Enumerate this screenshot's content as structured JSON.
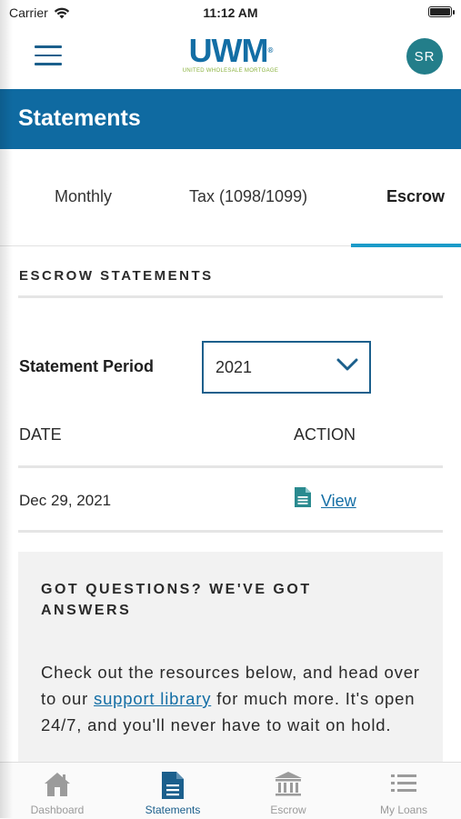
{
  "status_bar": {
    "carrier": "Carrier",
    "time": "11:12 AM"
  },
  "header": {
    "logo": "UWM",
    "logo_tagline": "UNITED WHOLESALE MORTGAGE",
    "avatar_initials": "SR"
  },
  "page_title": "Statements",
  "tabs": [
    {
      "label": "Monthly",
      "active": false
    },
    {
      "label": "Tax (1098/1099)",
      "active": false
    },
    {
      "label": "Escrow",
      "active": true
    }
  ],
  "escrow": {
    "section_title": "ESCROW STATEMENTS",
    "period_label": "Statement Period",
    "period_value": "2021",
    "table": {
      "headers": [
        "DATE",
        "ACTION"
      ],
      "rows": [
        {
          "date": "Dec 29, 2021",
          "action": "View"
        }
      ]
    }
  },
  "faq": {
    "title": "GOT QUESTIONS? WE'VE GOT ANSWERS",
    "text_before": "Check out the resources below, and head over to our ",
    "link": "support library",
    "text_after": " for much more. It's open 24/7, and you'll never have to wait on hold."
  },
  "bottom_nav": [
    {
      "label": "Dashboard",
      "icon": "home-icon",
      "active": false
    },
    {
      "label": "Statements",
      "icon": "document-icon",
      "active": true
    },
    {
      "label": "Escrow",
      "icon": "bank-icon",
      "active": false
    },
    {
      "label": "My Loans",
      "icon": "list-icon",
      "active": false
    }
  ],
  "colors": {
    "brand_blue": "#0f6aa1",
    "accent_teal": "#1b9bc9",
    "avatar_teal": "#237e8a",
    "logo_green": "#8ab23f"
  }
}
